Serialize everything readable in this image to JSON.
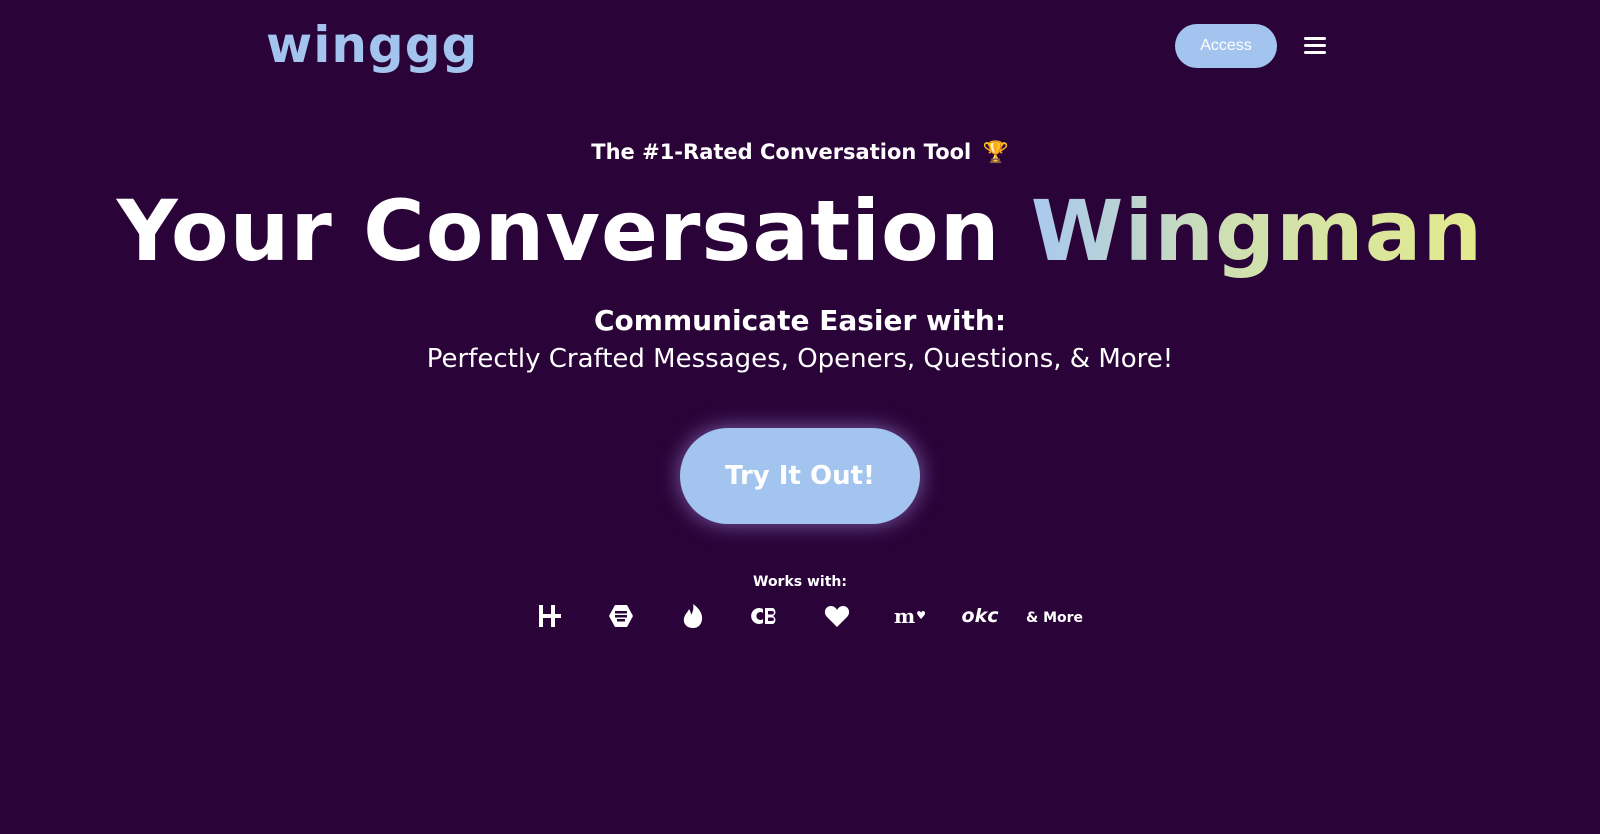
{
  "header": {
    "logo_text": "winggg",
    "access_label": "Access",
    "menu_icon": "hamburger-menu-icon"
  },
  "hero": {
    "tagline": "The #1-Rated Conversation Tool",
    "tagline_icon": "🏆",
    "headline_main": "Your Conversation",
    "headline_accent": "Wingman",
    "subhead": "Communicate Easier with:",
    "subline": "Perfectly Crafted Messages, Openers, Questions, & More!",
    "cta_label": "Try It Out!"
  },
  "works_with": {
    "label": "Works with:",
    "apps": [
      {
        "icon": "hinge-icon"
      },
      {
        "icon": "bumble-icon"
      },
      {
        "icon": "tinder-icon"
      },
      {
        "icon": "coffee-meets-bagel-icon"
      },
      {
        "icon": "heart-icon"
      },
      {
        "icon": "match-icon",
        "text": "m"
      },
      {
        "icon": "okcupid-icon",
        "text": "okc"
      }
    ],
    "more_label": "& More"
  },
  "colors": {
    "background": "#2a0338",
    "accent": "#a3c4ee",
    "gradient_start": "#a9c8f0",
    "gradient_end": "#e3ea8c"
  }
}
